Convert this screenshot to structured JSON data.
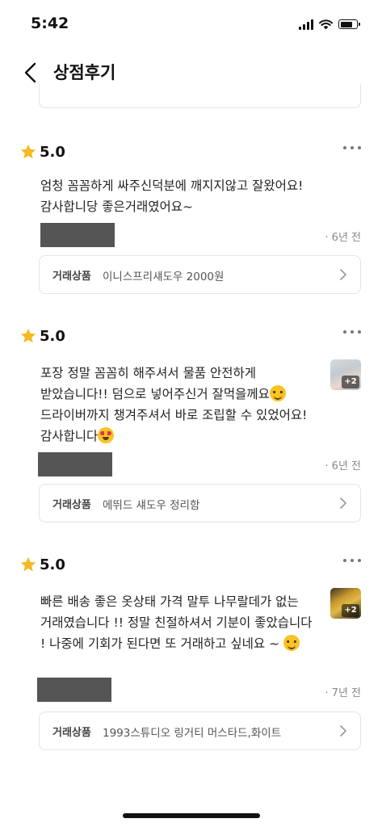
{
  "status_bar": {
    "time": "5:42"
  },
  "header": {
    "title": "상점후기"
  },
  "product_label": "거래상품",
  "reviews": [
    {
      "rating": "5.0",
      "text": "엄청 꼼꼼하게 싸주신덕분에 깨지지않고 잘왔어요! 감사합니당 좋은거래였어요~",
      "time_ago": "· 6년 전",
      "product": "이니스프리섀도우 2000원"
    },
    {
      "rating": "5.0",
      "text_1": "포장 정말 꼼꼼히 해주셔서 물품 안전하게 받았습니다!! 덤으로 넣어주신거 잘먹을께요",
      "text_2": " 드라이버까지 챙겨주셔서 바로 조립할 수 있었어요!감사합니다",
      "time_ago": "· 6년 전",
      "product": "에뛰드 섀도우 정리함",
      "photo_badge": "+2"
    },
    {
      "rating": "5.0",
      "text": "빠른 배송 좋은 옷상태 가격 말투 나무랄데가 없는 거래였습니다 !! 정말 친절하셔서 기분이 좋았습니다 ! 나중에 기회가 된다면 또 거래하고 싶네요 ~ ",
      "time_ago": "· 7년 전",
      "product": "1993스튜디오 링거티 머스타드,화이트",
      "photo_badge": "+2"
    }
  ],
  "colors": {
    "star": "#f5b921",
    "redacted": "#555555",
    "border": "#e4e4e4"
  }
}
